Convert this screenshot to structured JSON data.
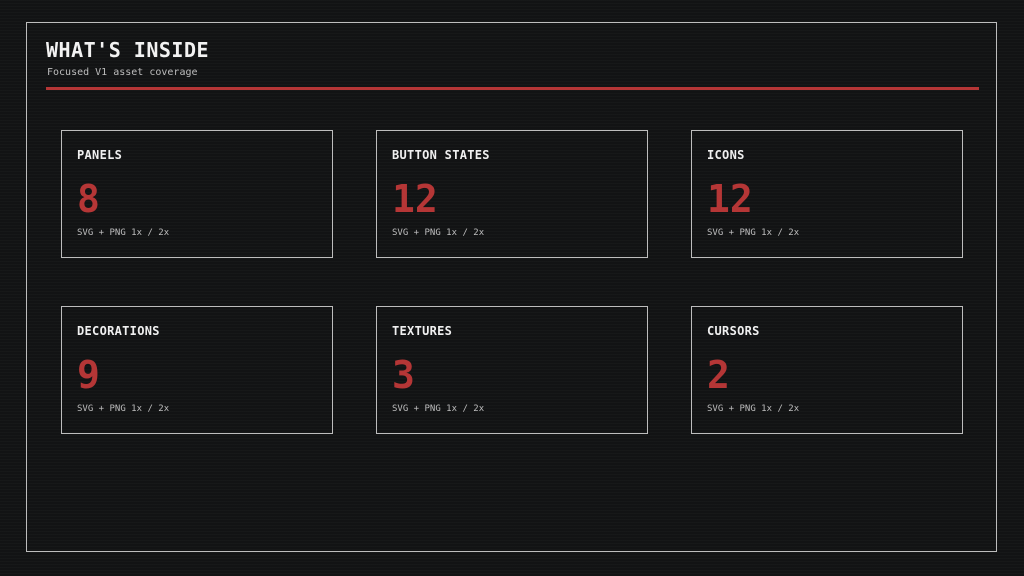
{
  "header": {
    "title": "WHAT'S INSIDE",
    "subtitle": "Focused V1 asset coverage"
  },
  "colors": {
    "accent": "#b53636",
    "background": "#121314",
    "border": "#bdbdbd",
    "text": "#f0f0f0"
  },
  "cards": [
    {
      "label": "PANELS",
      "count": "8",
      "formats": "SVG + PNG 1x / 2x"
    },
    {
      "label": "BUTTON STATES",
      "count": "12",
      "formats": "SVG + PNG 1x / 2x"
    },
    {
      "label": "ICONS",
      "count": "12",
      "formats": "SVG + PNG 1x / 2x"
    },
    {
      "label": "DECORATIONS",
      "count": "9",
      "formats": "SVG + PNG 1x / 2x"
    },
    {
      "label": "TEXTURES",
      "count": "3",
      "formats": "SVG + PNG 1x / 2x"
    },
    {
      "label": "CURSORS",
      "count": "2",
      "formats": "SVG + PNG 1x / 2x"
    }
  ]
}
